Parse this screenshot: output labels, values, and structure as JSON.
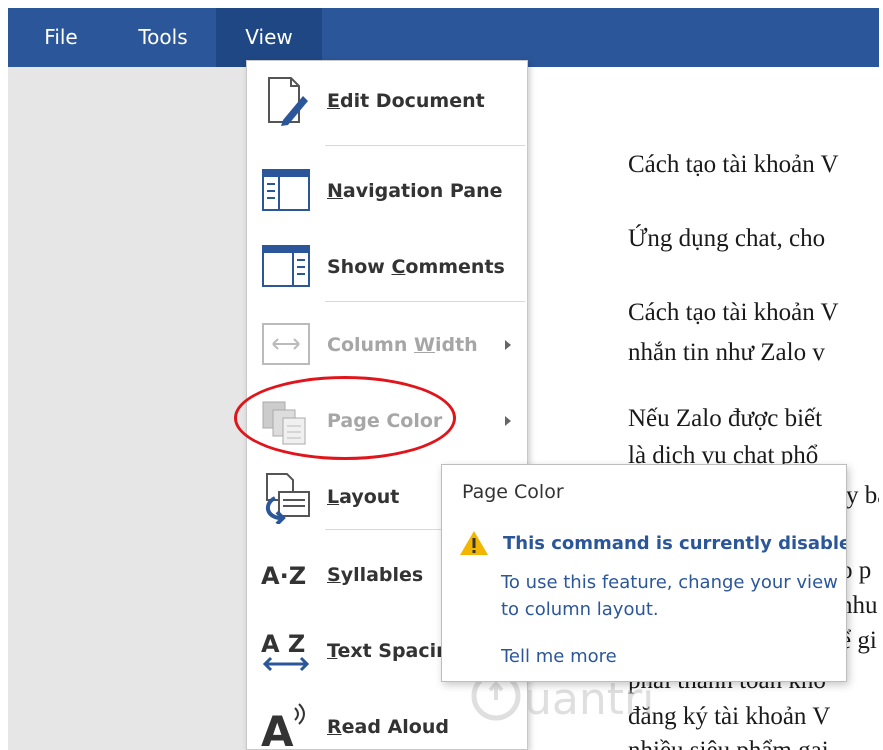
{
  "menubar": {
    "items": [
      {
        "label": "File"
      },
      {
        "label": "Tools"
      },
      {
        "label": "View",
        "active": true
      }
    ]
  },
  "view_menu": {
    "items": [
      {
        "label": "Edit Document",
        "access_key": "E",
        "rest": "dit Document",
        "icon": "edit-document-icon",
        "enabled": true
      },
      {
        "label": "Navigation Pane",
        "access_key": "N",
        "rest": "avigation Pane",
        "icon": "navigation-pane-icon",
        "enabled": true
      },
      {
        "label": "Show Comments",
        "pre": "Show ",
        "access_key": "C",
        "rest": "omments",
        "icon": "show-comments-icon",
        "enabled": true
      },
      {
        "label": "Column Width",
        "pre": "Column ",
        "access_key": "W",
        "rest": "idth",
        "icon": "column-width-icon",
        "enabled": false,
        "submenu": true
      },
      {
        "label": "Page Color",
        "icon": "page-color-icon",
        "enabled": false,
        "submenu": true
      },
      {
        "label": "Layout",
        "access_key": "L",
        "rest": "ayout",
        "icon": "layout-icon",
        "enabled": true
      },
      {
        "label": "Syllables",
        "access_key": "S",
        "rest": "yllables",
        "icon": "syllables-icon",
        "enabled": true
      },
      {
        "label": "Text Spacing",
        "visible": "Text Spacin",
        "access_key": "T",
        "rest": "ext Spacin",
        "icon": "text-spacing-icon",
        "enabled": true
      },
      {
        "label": "Read Aloud",
        "access_key": "R",
        "rest": "ead Aloud",
        "icon": "read-aloud-icon",
        "enabled": true
      }
    ]
  },
  "tooltip": {
    "title": "Page Color",
    "disabled_text": "This command is currently disabled.",
    "description": "To use this feature, change your view to column layout.",
    "link": "Tell me more",
    "icon": "warning-icon"
  },
  "document": {
    "lines": [
      "Cách tạo tài khoản V",
      "Ứng dụng chat, cho",
      "Cách tạo tài khoản V",
      "nhắn tin như Zalo v",
      "Nếu Zalo được biết",
      "là dịch vụ chat phổ",
      "y bấ",
      "o p",
      "nhu",
      "ể gi",
      "phải thanh toán kho",
      "đăng ký tài khoản V",
      "nhiều siêu phẩm gai"
    ]
  },
  "watermark": {
    "icon": "quantrimang-logo-icon"
  },
  "colors": {
    "menubar": "#2b579a",
    "menubar_active": "#1f4784",
    "annotation": "#e0151b",
    "link": "#2b579a",
    "warning": "#f2b600"
  }
}
